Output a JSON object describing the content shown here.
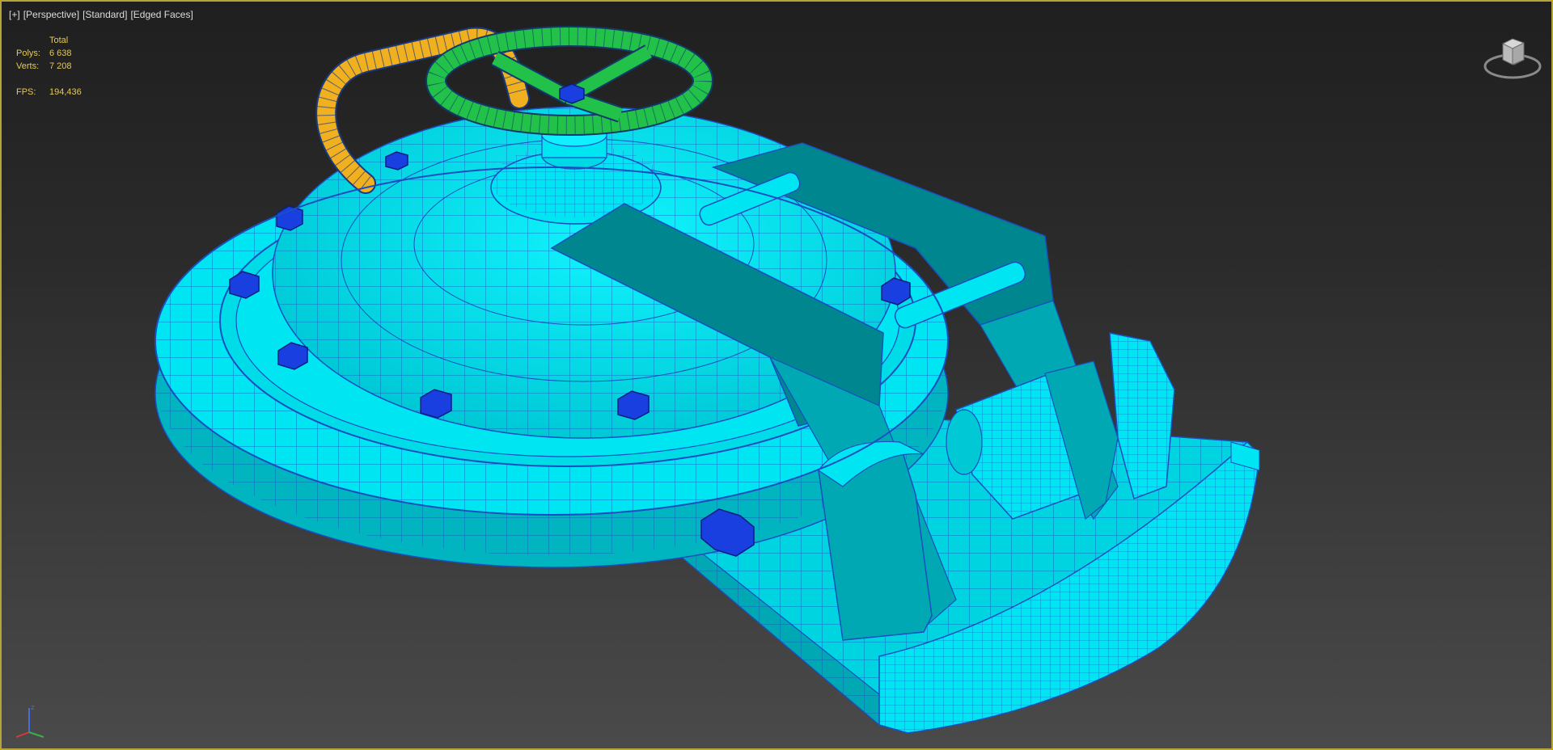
{
  "viewport": {
    "labels": [
      "[+]",
      "[Perspective]",
      "[Standard]",
      "[Edged Faces]"
    ]
  },
  "stats": {
    "header": "Total",
    "polys_label": "Polys:",
    "polys_value": "6 638",
    "verts_label": "Verts:",
    "verts_value": "7 208",
    "fps_label": "FPS:",
    "fps_value": "194,436"
  },
  "colors": {
    "frame_border": "#b8a23a",
    "stats_text": "#e6c85a",
    "model_cyan": "#00e5f2",
    "model_shade": "#00a8b4",
    "model_dark": "#007f8a",
    "wireframe": "#1a4fc0",
    "bolts": "#1a3fe0",
    "handwheel": "#22c24a",
    "pipe": "#f0b020"
  },
  "icons": {
    "viewcube": "viewcube-icon",
    "axis": "axis-tripod-icon"
  }
}
